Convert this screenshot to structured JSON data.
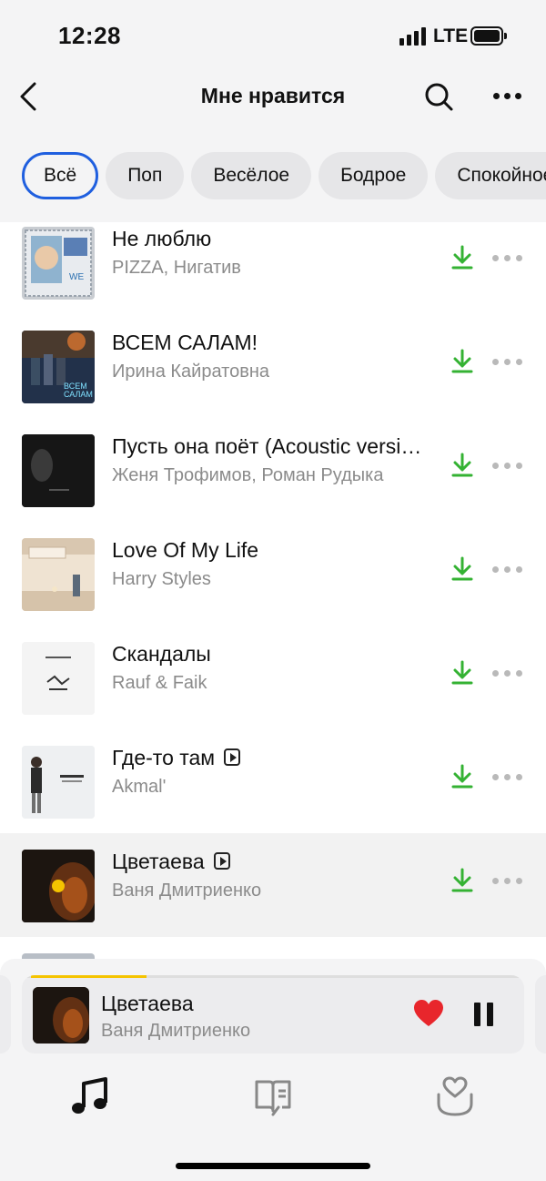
{
  "status_bar": {
    "time": "12:28",
    "network": "LTE"
  },
  "header": {
    "title": "Мне нравится"
  },
  "filters": [
    "Всё",
    "Поп",
    "Весёлое",
    "Бодрое",
    "Спокойное"
  ],
  "tracks": [
    {
      "title": "Не люблю",
      "artist": "PIZZA, Нигатив",
      "video": false
    },
    {
      "title": "ВСЕМ САЛАМ!",
      "artist": "Ирина Кайратовна",
      "video": false
    },
    {
      "title": "Пусть она поёт (Acoustic version)",
      "artist": "Женя Трофимов, Роман Рудыка",
      "video": false
    },
    {
      "title": "Love Of My Life",
      "artist": "Harry Styles",
      "video": false
    },
    {
      "title": "Скандалы",
      "artist": "Rauf & Faik",
      "video": false
    },
    {
      "title": "Где-то там",
      "artist": "Akmal'",
      "video": true
    },
    {
      "title": "Цветаева",
      "artist": "Ваня Дмитриенко",
      "video": true,
      "playing": true
    }
  ],
  "now_playing": {
    "title": "Цветаева",
    "artist": "Ваня Дмитриенко",
    "progress": 0.23,
    "liked": true
  },
  "tabs": [
    {
      "name": "music",
      "icon": "music-note-icon",
      "active": true
    },
    {
      "name": "library",
      "icon": "book-icon",
      "active": false
    },
    {
      "name": "favorites",
      "icon": "heart-hands-icon",
      "active": false
    }
  ],
  "colors": {
    "accent_blue": "#1f5fdf",
    "download_green": "#34b233",
    "heart_red": "#e8262c",
    "progress_yellow": "#f5c400"
  }
}
